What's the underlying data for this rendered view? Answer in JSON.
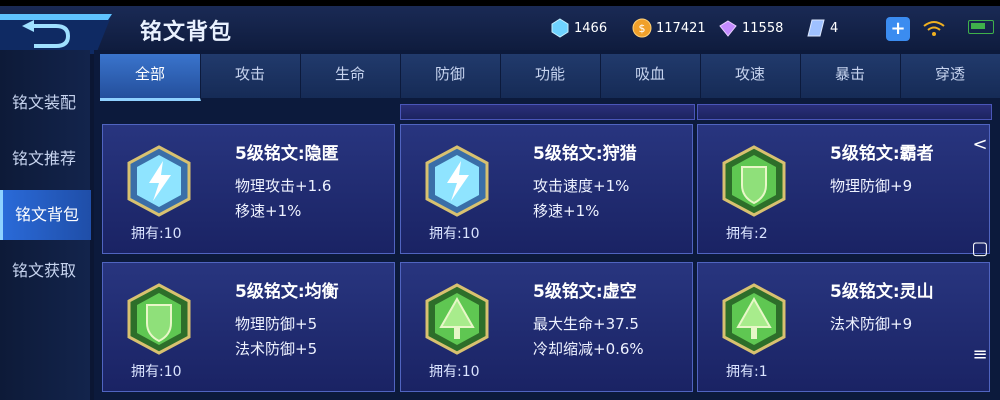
{
  "header": {
    "title": "铭文背包",
    "resources": [
      {
        "icon": "crystal-icon",
        "value": "1466",
        "color": "#6fd3ff"
      },
      {
        "icon": "gold-coin-icon",
        "value": "117421",
        "color": "#f0a02a"
      },
      {
        "icon": "diamond-icon",
        "value": "11558",
        "color": "#c48cff"
      },
      {
        "icon": "ticket-icon",
        "value": "4",
        "color": "#9fc1ff"
      }
    ],
    "plus_label": "+"
  },
  "sidebar": {
    "items": [
      {
        "label": "铭文装配",
        "active": false
      },
      {
        "label": "铭文推荐",
        "active": false
      },
      {
        "label": "铭文背包",
        "active": true
      },
      {
        "label": "铭文获取",
        "active": false
      }
    ]
  },
  "tabs": [
    {
      "label": "全部",
      "active": true
    },
    {
      "label": "攻击",
      "active": false
    },
    {
      "label": "生命",
      "active": false
    },
    {
      "label": "防御",
      "active": false
    },
    {
      "label": "功能",
      "active": false
    },
    {
      "label": "吸血",
      "active": false
    },
    {
      "label": "攻速",
      "active": false
    },
    {
      "label": "暴击",
      "active": false
    },
    {
      "label": "穿透",
      "active": false
    }
  ],
  "cards": [
    {
      "name": "5级铭文:隐匿",
      "stat1": "物理攻击+1.6",
      "stat2": "移速+1%",
      "own": "拥有:10",
      "icon": "blue-lightning-rune-icon",
      "color": "#7fd6ff"
    },
    {
      "name": "5级铭文:狩猎",
      "stat1": "攻击速度+1%",
      "stat2": "移速+1%",
      "own": "拥有:10",
      "icon": "blue-lightning-rune-icon",
      "color": "#7fd6ff"
    },
    {
      "name": "5级铭文:霸者",
      "stat1": "物理防御+9",
      "stat2": "",
      "own": "拥有:2",
      "icon": "green-shield-rune-icon",
      "color": "#4fbf4a"
    },
    {
      "name": "5级铭文:均衡",
      "stat1": "物理防御+5",
      "stat2": "法术防御+5",
      "own": "拥有:10",
      "icon": "green-shield-rune-icon",
      "color": "#4fbf4a"
    },
    {
      "name": "5级铭文:虚空",
      "stat1": "最大生命+37.5",
      "stat2": "冷却缩减+0.6%",
      "own": "拥有:10",
      "icon": "green-tree-rune-icon",
      "color": "#4fbf4a"
    },
    {
      "name": "5级铭文:灵山",
      "stat1": "法术防御+9",
      "stat2": "",
      "own": "拥有:1",
      "icon": "green-tree-rune-icon",
      "color": "#4fbf4a"
    }
  ],
  "system_nav": [
    {
      "icon": "back-chevron-icon",
      "glyph": "<"
    },
    {
      "icon": "home-square-icon",
      "glyph": "▢"
    },
    {
      "icon": "menu-icon",
      "glyph": "≡"
    }
  ]
}
